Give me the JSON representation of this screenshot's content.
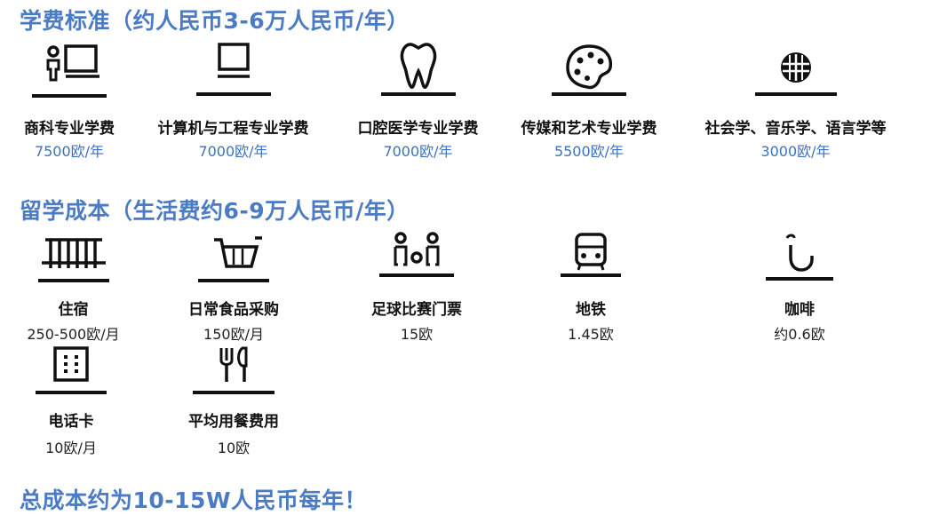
{
  "headings": {
    "tuition": "学费标准（约人民币3-6万人民币/年）",
    "living": "留学成本（生活费约6-9万人民币/年）",
    "total": "总成本约为10-15W人民币每年！"
  },
  "tuition_items": [
    {
      "label": "商科专业学费",
      "price": "7500欧/年",
      "icon": "presenter-desk-icon"
    },
    {
      "label": "计算机与工程专业学费",
      "price": "7000欧/年",
      "icon": "computer-monitor-icon"
    },
    {
      "label": "口腔医学专业学费",
      "price": "7000欧/年",
      "icon": "tooth-icon"
    },
    {
      "label": "传媒和艺术专业学费",
      "price": "5500欧/年",
      "icon": "art-palette-icon"
    },
    {
      "label": "社会学、音乐学、语言学等",
      "price": "3000欧/年",
      "icon": "globe-icon"
    }
  ],
  "living_items": [
    {
      "label": "住宿",
      "price": "250-500欧/月",
      "icon": "housing-fence-icon"
    },
    {
      "label": "日常食品采购",
      "price": "150欧/月",
      "icon": "shopping-cart-icon"
    },
    {
      "label": "足球比赛门票",
      "price": "15欧",
      "icon": "audience-people-icon"
    },
    {
      "label": "地铁",
      "price": "1.45欧",
      "icon": "subway-train-icon"
    },
    {
      "label": "咖啡",
      "price": "约0.6欧",
      "icon": "coffee-cup-icon"
    },
    {
      "label": "电话卡",
      "price": "10欧/月",
      "icon": "phone-card-icon"
    },
    {
      "label": "平均用餐费用",
      "price": "10欧",
      "icon": "fork-knife-icon"
    }
  ],
  "colors": {
    "heading": "#4a7bc4",
    "tuition_price": "#3d72c0",
    "icon": "#111111"
  }
}
